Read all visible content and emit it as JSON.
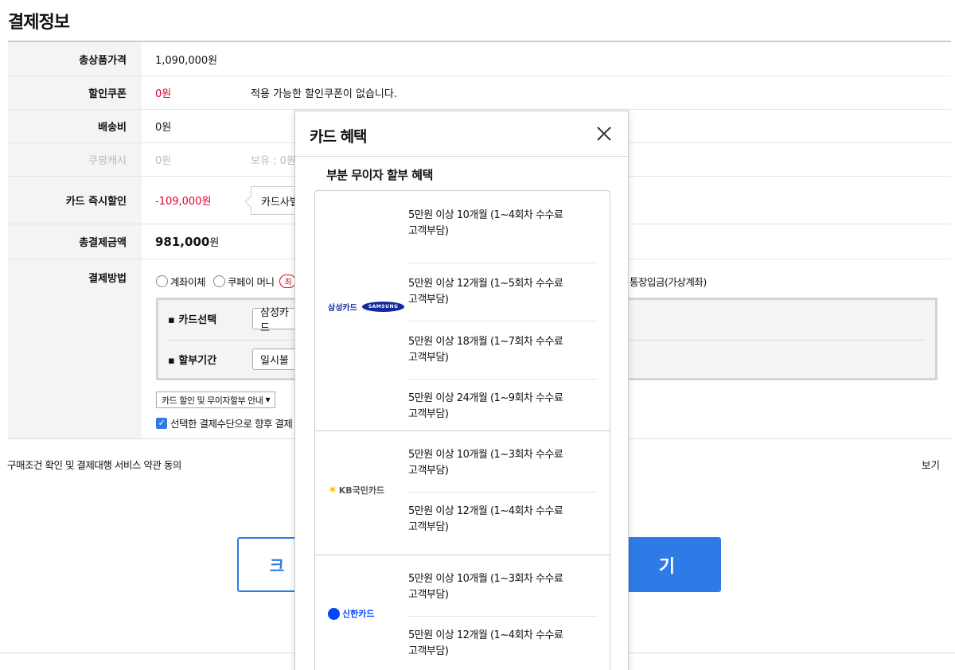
{
  "page_title": "결제정보",
  "rows": {
    "total_price": {
      "label": "총상품가격",
      "value": "1,090,000원"
    },
    "coupon": {
      "label": "할인쿠폰",
      "value": "0원",
      "note": "적용 가능한 할인쿠폰이 없습니다."
    },
    "shipping": {
      "label": "배송비",
      "value": "0원"
    },
    "coupang_cash": {
      "label": "쿠팡캐시",
      "value": "0원",
      "note": "보유 : 0원"
    },
    "card_discount": {
      "label": "카드 즉시할인",
      "value": "-109,000원",
      "tooltip": "카드사별"
    },
    "final_amount": {
      "label": "총결제금액",
      "value": "981,000",
      "unit": "원"
    },
    "pay_method": {
      "label": "결제방법"
    }
  },
  "pay_options": {
    "bank_transfer": "계좌이체",
    "coupay_money": "쿠페이 머니",
    "badge": "최",
    "virtual_account": "통장입금(가상계좌)"
  },
  "card_box": {
    "card_select_label": "▪ 카드선택",
    "card_select_value": "삼성카드",
    "installment_label": "▪ 할부기간",
    "installment_value": "일시불"
  },
  "card_guide_select": "카드 할인 및 무이자할부 안내",
  "save_method_label": "선택한 결제수단으로 향후 결제",
  "terms": {
    "label": "구매조건 확인 및 결제대행 서비스 약관 동의",
    "view": "보기"
  },
  "buttons": {
    "back": "크",
    "pay": "기"
  },
  "modal": {
    "title": "카드 혜택",
    "subtitle": "부분 무이자 할부 혜택",
    "banks": [
      {
        "name": "삼성카드",
        "wordmark": "SAMSUNG",
        "entries": [
          {
            "line1": "5만원 이상 10개월 (1~4회차 수수료",
            "line2": "고객부담)"
          },
          {
            "line1": "5만원 이상 12개월 (1~5회차 수수료",
            "line2": "고객부담)"
          },
          {
            "line1": "5만원 이상 18개월 (1~7회차 수수료",
            "line2": "고객부담)"
          },
          {
            "line1": "5만원 이상 24개월 (1~9회차 수수료",
            "line2": "고객부담)"
          }
        ]
      },
      {
        "name": "KB국민카드",
        "entries": [
          {
            "line1": "5만원 이상 10개월 (1~3회차 수수료",
            "line2": "고객부담)"
          },
          {
            "line1": "5만원 이상 12개월 (1~4회차 수수료",
            "line2": "고객부담)"
          }
        ]
      },
      {
        "name": "신한카드",
        "entries": [
          {
            "line1": "5만원 이상 10개월 (1~3회차 수수료",
            "line2": "고객부담)"
          },
          {
            "line1": "5만원 이상 12개월 (1~4회차 수수료",
            "line2": "고객부담)"
          }
        ]
      }
    ]
  },
  "colors": {
    "accent": "#2e7be8",
    "discount_red": "#e4002b",
    "samsung_blue": "#1428a0",
    "kb_yellow": "#f6b300",
    "shinhan_blue": "#0046ff"
  }
}
